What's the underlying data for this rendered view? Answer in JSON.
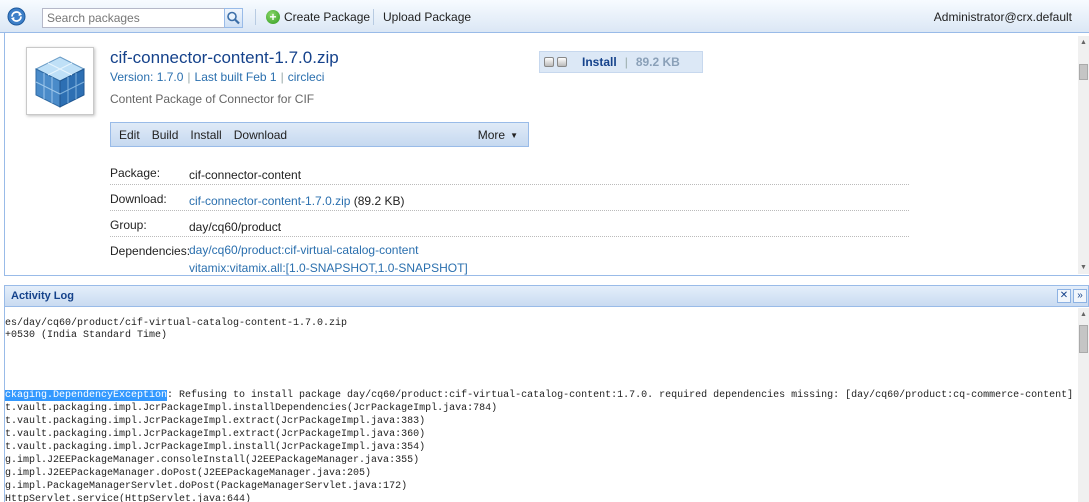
{
  "toolbar": {
    "search_placeholder": "Search packages",
    "create_label": "Create Package",
    "upload_label": "Upload Package",
    "user": "Administrator@crx.default"
  },
  "package": {
    "title": "cif-connector-content-1.7.0.zip",
    "version": "Version: 1.7.0",
    "last_built": "Last built Feb 1",
    "builder": "circleci",
    "description": "Content Package of Connector for CIF",
    "install_label": "Install",
    "install_size": "89.2 KB"
  },
  "actions": {
    "edit": "Edit",
    "build": "Build",
    "install": "Install",
    "download": "Download",
    "more": "More"
  },
  "properties": {
    "package_label": "Package:",
    "package_value": "cif-connector-content",
    "download_label": "Download:",
    "download_link": "cif-connector-content-1.7.0.zip",
    "download_size": "(89.2 KB)",
    "group_label": "Group:",
    "group_value": "day/cq60/product",
    "dependencies_label": "Dependencies:",
    "dependency_1": "day/cq60/product:cif-virtual-catalog-content",
    "dependency_2": "vitamix:vitamix.all:[1.0-SNAPSHOT,1.0-SNAPSHOT]"
  },
  "activity_log": {
    "title": "Activity Log",
    "line_1": "es/day/cq60/product/cif-virtual-catalog-content-1.7.0.zip",
    "line_2": "+0530 (India Standard Time)",
    "exception_highlight": "ckaging.DependencyException",
    "exception_message": ": Refusing to install package day/cq60/product:cif-virtual-catalog-content:1.7.0. required dependencies missing: [day/cq60/product:cq-commerce-content]",
    "trace_1": "t.vault.packaging.impl.JcrPackageImpl.installDependencies(JcrPackageImpl.java:784)",
    "trace_2": "t.vault.packaging.impl.JcrPackageImpl.extract(JcrPackageImpl.java:383)",
    "trace_3": "t.vault.packaging.impl.JcrPackageImpl.extract(JcrPackageImpl.java:360)",
    "trace_4": "t.vault.packaging.impl.JcrPackageImpl.install(JcrPackageImpl.java:354)",
    "trace_5": "g.impl.J2EEPackageManager.consoleInstall(J2EEPackageManager.java:355)",
    "trace_6": "g.impl.J2EEPackageManager.doPost(J2EEPackageManager.java:205)",
    "trace_7": "g.impl.PackageManagerServlet.doPost(PackageManagerServlet.java:172)",
    "trace_8": "HttpServlet.service(HttpServlet.java:644)"
  }
}
